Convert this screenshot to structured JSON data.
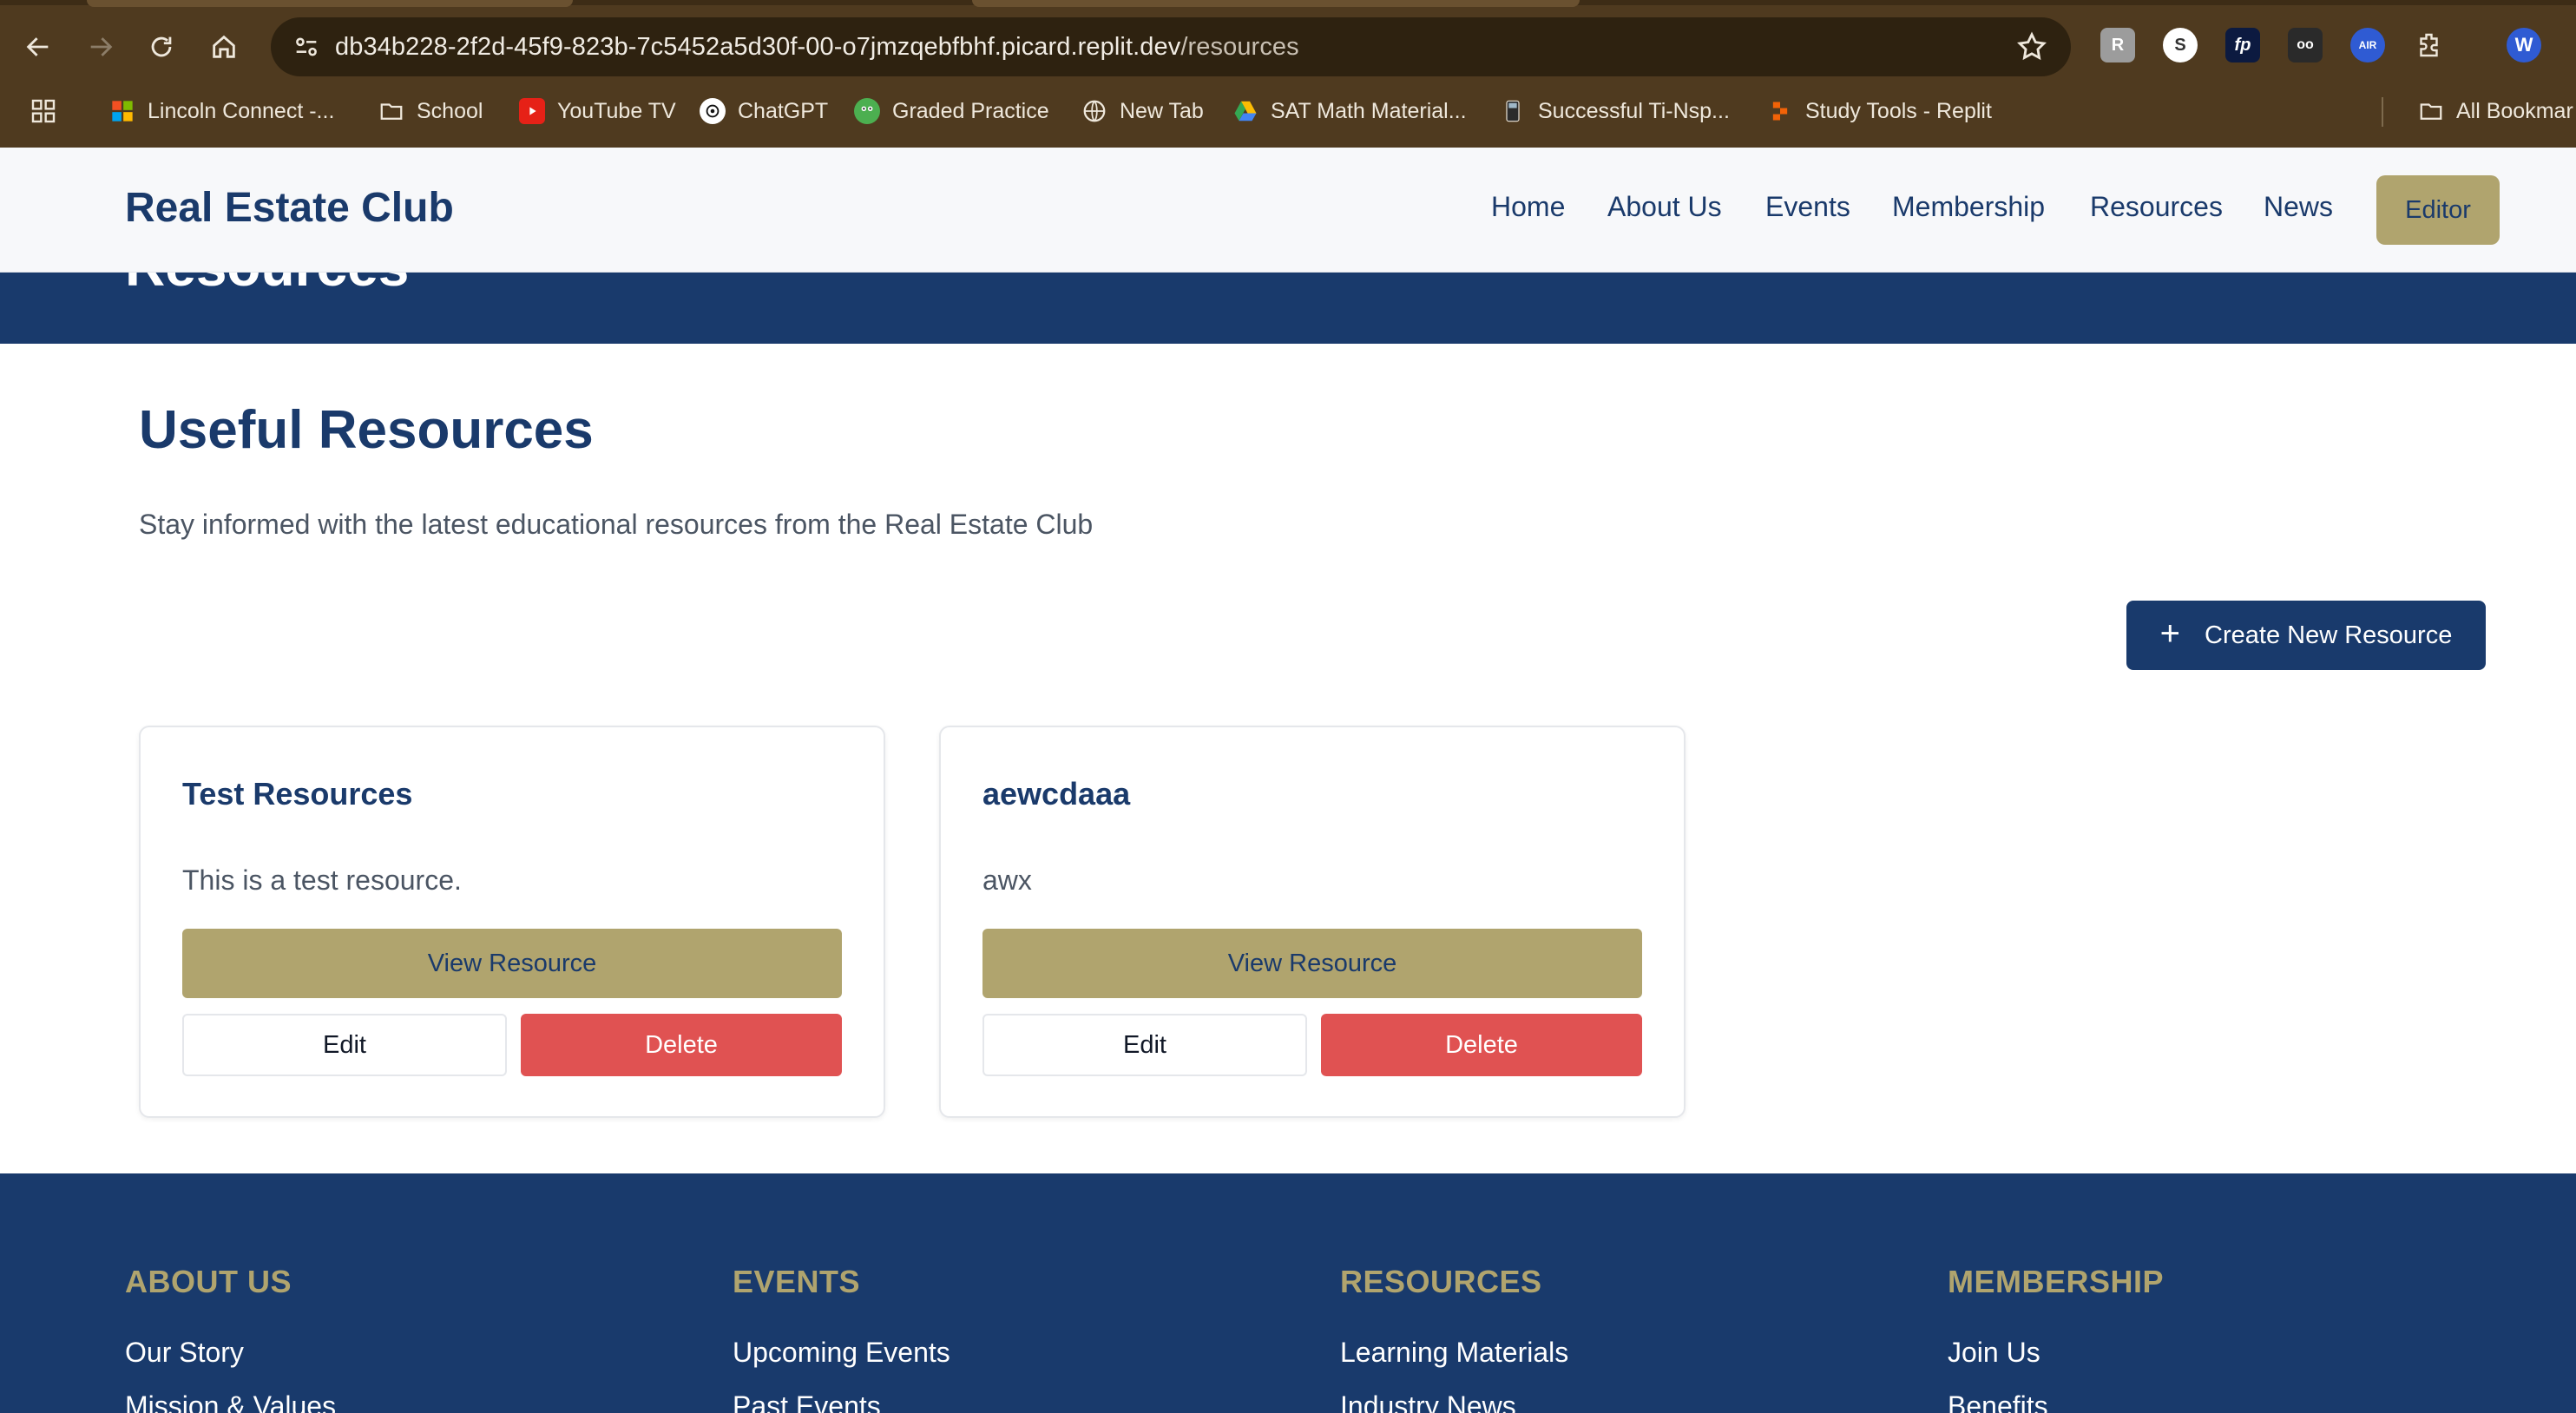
{
  "browser": {
    "url_host": "db34b228-2f2d-45f9-823b-7c5452a5d30f-00-o7jmzqebfbhf.picard.replit.dev",
    "url_path": "/resources",
    "profile_initial": "W",
    "extensions": [
      "puzzle-r-extension",
      "s-extension",
      "fp-extension",
      "goggles-extension",
      "air-extension"
    ],
    "bookmarks": [
      {
        "label": "Lincoln Connect -...",
        "icon": "windows-logo-icon"
      },
      {
        "label": "School",
        "icon": "folder-icon"
      },
      {
        "label": "YouTube TV",
        "icon": "youtube-icon"
      },
      {
        "label": "ChatGPT",
        "icon": "chatgpt-icon"
      },
      {
        "label": "Graded Practice",
        "icon": "frog-icon"
      },
      {
        "label": "New Tab",
        "icon": "globe-icon"
      },
      {
        "label": "SAT Math Material...",
        "icon": "google-drive-icon"
      },
      {
        "label": "Successful Ti-Nsp...",
        "icon": "calculator-icon"
      },
      {
        "label": "Study Tools - Replit",
        "icon": "replit-icon"
      }
    ],
    "all_bookmarks_label": "All Bookmar"
  },
  "header": {
    "brand": "Real Estate Club",
    "nav": [
      "Home",
      "About Us",
      "Events",
      "Membership",
      "Resources",
      "News"
    ],
    "editor_label": "Editor"
  },
  "hero": {
    "title": "Resources"
  },
  "main": {
    "title": "Useful Resources",
    "subtitle": "Stay informed with the latest educational resources from the Real Estate Club",
    "create_label": "Create New Resource",
    "cards": [
      {
        "title": "Test Resources",
        "description": "This is a test resource.",
        "view_label": "View Resource",
        "edit_label": "Edit",
        "delete_label": "Delete"
      },
      {
        "title": "aewcdaaa",
        "description": "awx",
        "view_label": "View Resource",
        "edit_label": "Edit",
        "delete_label": "Delete"
      }
    ]
  },
  "footer": {
    "columns": [
      {
        "heading": "ABOUT US",
        "links": [
          "Our Story",
          "Mission & Values"
        ]
      },
      {
        "heading": "EVENTS",
        "links": [
          "Upcoming Events",
          "Past Events"
        ]
      },
      {
        "heading": "RESOURCES",
        "links": [
          "Learning Materials",
          "Industry News"
        ]
      },
      {
        "heading": "MEMBERSHIP",
        "links": [
          "Join Us",
          "Benefits"
        ]
      }
    ]
  },
  "colors": {
    "navy": "#193a6c",
    "gold": "#b0a46e",
    "danger": "#e05252",
    "chrome": "#4f3a1f"
  }
}
